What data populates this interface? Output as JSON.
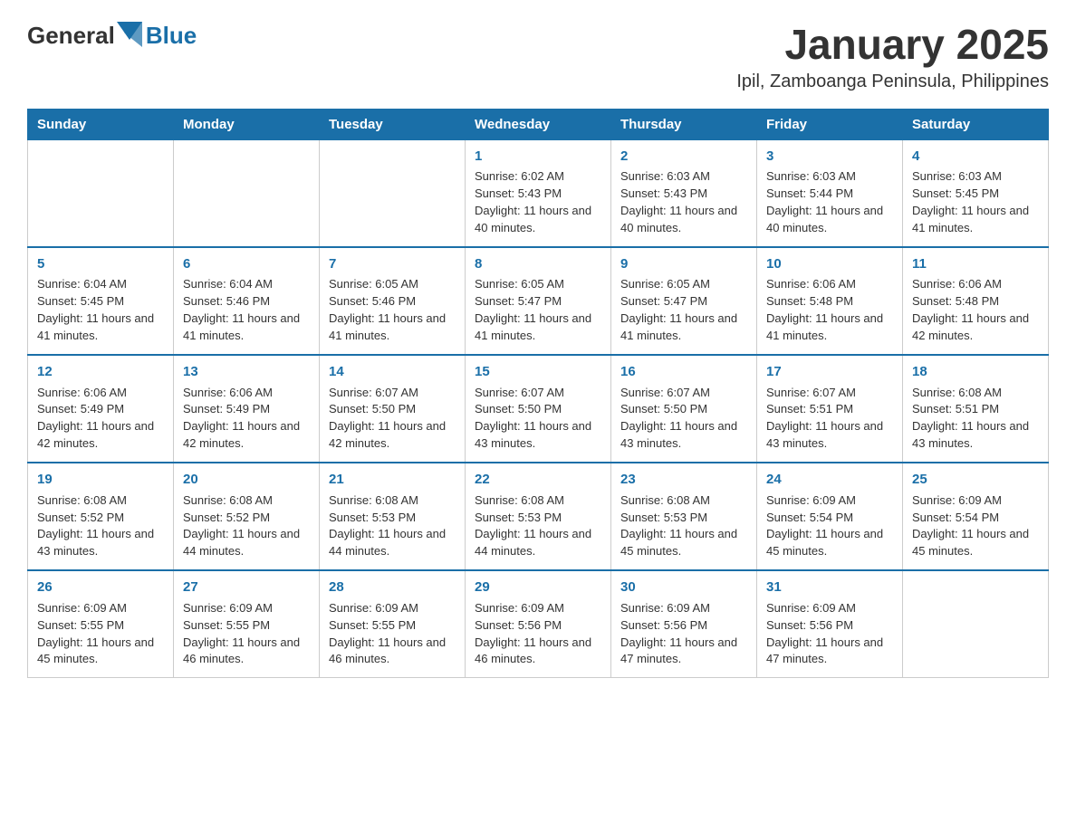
{
  "header": {
    "logo_general": "General",
    "logo_blue": "Blue",
    "month_year": "January 2025",
    "location": "Ipil, Zamboanga Peninsula, Philippines"
  },
  "days_of_week": [
    "Sunday",
    "Monday",
    "Tuesday",
    "Wednesday",
    "Thursday",
    "Friday",
    "Saturday"
  ],
  "weeks": [
    [
      {
        "day": "",
        "sunrise": "",
        "sunset": "",
        "daylight": ""
      },
      {
        "day": "",
        "sunrise": "",
        "sunset": "",
        "daylight": ""
      },
      {
        "day": "",
        "sunrise": "",
        "sunset": "",
        "daylight": ""
      },
      {
        "day": "1",
        "sunrise": "Sunrise: 6:02 AM",
        "sunset": "Sunset: 5:43 PM",
        "daylight": "Daylight: 11 hours and 40 minutes."
      },
      {
        "day": "2",
        "sunrise": "Sunrise: 6:03 AM",
        "sunset": "Sunset: 5:43 PM",
        "daylight": "Daylight: 11 hours and 40 minutes."
      },
      {
        "day": "3",
        "sunrise": "Sunrise: 6:03 AM",
        "sunset": "Sunset: 5:44 PM",
        "daylight": "Daylight: 11 hours and 40 minutes."
      },
      {
        "day": "4",
        "sunrise": "Sunrise: 6:03 AM",
        "sunset": "Sunset: 5:45 PM",
        "daylight": "Daylight: 11 hours and 41 minutes."
      }
    ],
    [
      {
        "day": "5",
        "sunrise": "Sunrise: 6:04 AM",
        "sunset": "Sunset: 5:45 PM",
        "daylight": "Daylight: 11 hours and 41 minutes."
      },
      {
        "day": "6",
        "sunrise": "Sunrise: 6:04 AM",
        "sunset": "Sunset: 5:46 PM",
        "daylight": "Daylight: 11 hours and 41 minutes."
      },
      {
        "day": "7",
        "sunrise": "Sunrise: 6:05 AM",
        "sunset": "Sunset: 5:46 PM",
        "daylight": "Daylight: 11 hours and 41 minutes."
      },
      {
        "day": "8",
        "sunrise": "Sunrise: 6:05 AM",
        "sunset": "Sunset: 5:47 PM",
        "daylight": "Daylight: 11 hours and 41 minutes."
      },
      {
        "day": "9",
        "sunrise": "Sunrise: 6:05 AM",
        "sunset": "Sunset: 5:47 PM",
        "daylight": "Daylight: 11 hours and 41 minutes."
      },
      {
        "day": "10",
        "sunrise": "Sunrise: 6:06 AM",
        "sunset": "Sunset: 5:48 PM",
        "daylight": "Daylight: 11 hours and 41 minutes."
      },
      {
        "day": "11",
        "sunrise": "Sunrise: 6:06 AM",
        "sunset": "Sunset: 5:48 PM",
        "daylight": "Daylight: 11 hours and 42 minutes."
      }
    ],
    [
      {
        "day": "12",
        "sunrise": "Sunrise: 6:06 AM",
        "sunset": "Sunset: 5:49 PM",
        "daylight": "Daylight: 11 hours and 42 minutes."
      },
      {
        "day": "13",
        "sunrise": "Sunrise: 6:06 AM",
        "sunset": "Sunset: 5:49 PM",
        "daylight": "Daylight: 11 hours and 42 minutes."
      },
      {
        "day": "14",
        "sunrise": "Sunrise: 6:07 AM",
        "sunset": "Sunset: 5:50 PM",
        "daylight": "Daylight: 11 hours and 42 minutes."
      },
      {
        "day": "15",
        "sunrise": "Sunrise: 6:07 AM",
        "sunset": "Sunset: 5:50 PM",
        "daylight": "Daylight: 11 hours and 43 minutes."
      },
      {
        "day": "16",
        "sunrise": "Sunrise: 6:07 AM",
        "sunset": "Sunset: 5:50 PM",
        "daylight": "Daylight: 11 hours and 43 minutes."
      },
      {
        "day": "17",
        "sunrise": "Sunrise: 6:07 AM",
        "sunset": "Sunset: 5:51 PM",
        "daylight": "Daylight: 11 hours and 43 minutes."
      },
      {
        "day": "18",
        "sunrise": "Sunrise: 6:08 AM",
        "sunset": "Sunset: 5:51 PM",
        "daylight": "Daylight: 11 hours and 43 minutes."
      }
    ],
    [
      {
        "day": "19",
        "sunrise": "Sunrise: 6:08 AM",
        "sunset": "Sunset: 5:52 PM",
        "daylight": "Daylight: 11 hours and 43 minutes."
      },
      {
        "day": "20",
        "sunrise": "Sunrise: 6:08 AM",
        "sunset": "Sunset: 5:52 PM",
        "daylight": "Daylight: 11 hours and 44 minutes."
      },
      {
        "day": "21",
        "sunrise": "Sunrise: 6:08 AM",
        "sunset": "Sunset: 5:53 PM",
        "daylight": "Daylight: 11 hours and 44 minutes."
      },
      {
        "day": "22",
        "sunrise": "Sunrise: 6:08 AM",
        "sunset": "Sunset: 5:53 PM",
        "daylight": "Daylight: 11 hours and 44 minutes."
      },
      {
        "day": "23",
        "sunrise": "Sunrise: 6:08 AM",
        "sunset": "Sunset: 5:53 PM",
        "daylight": "Daylight: 11 hours and 45 minutes."
      },
      {
        "day": "24",
        "sunrise": "Sunrise: 6:09 AM",
        "sunset": "Sunset: 5:54 PM",
        "daylight": "Daylight: 11 hours and 45 minutes."
      },
      {
        "day": "25",
        "sunrise": "Sunrise: 6:09 AM",
        "sunset": "Sunset: 5:54 PM",
        "daylight": "Daylight: 11 hours and 45 minutes."
      }
    ],
    [
      {
        "day": "26",
        "sunrise": "Sunrise: 6:09 AM",
        "sunset": "Sunset: 5:55 PM",
        "daylight": "Daylight: 11 hours and 45 minutes."
      },
      {
        "day": "27",
        "sunrise": "Sunrise: 6:09 AM",
        "sunset": "Sunset: 5:55 PM",
        "daylight": "Daylight: 11 hours and 46 minutes."
      },
      {
        "day": "28",
        "sunrise": "Sunrise: 6:09 AM",
        "sunset": "Sunset: 5:55 PM",
        "daylight": "Daylight: 11 hours and 46 minutes."
      },
      {
        "day": "29",
        "sunrise": "Sunrise: 6:09 AM",
        "sunset": "Sunset: 5:56 PM",
        "daylight": "Daylight: 11 hours and 46 minutes."
      },
      {
        "day": "30",
        "sunrise": "Sunrise: 6:09 AM",
        "sunset": "Sunset: 5:56 PM",
        "daylight": "Daylight: 11 hours and 47 minutes."
      },
      {
        "day": "31",
        "sunrise": "Sunrise: 6:09 AM",
        "sunset": "Sunset: 5:56 PM",
        "daylight": "Daylight: 11 hours and 47 minutes."
      },
      {
        "day": "",
        "sunrise": "",
        "sunset": "",
        "daylight": ""
      }
    ]
  ]
}
